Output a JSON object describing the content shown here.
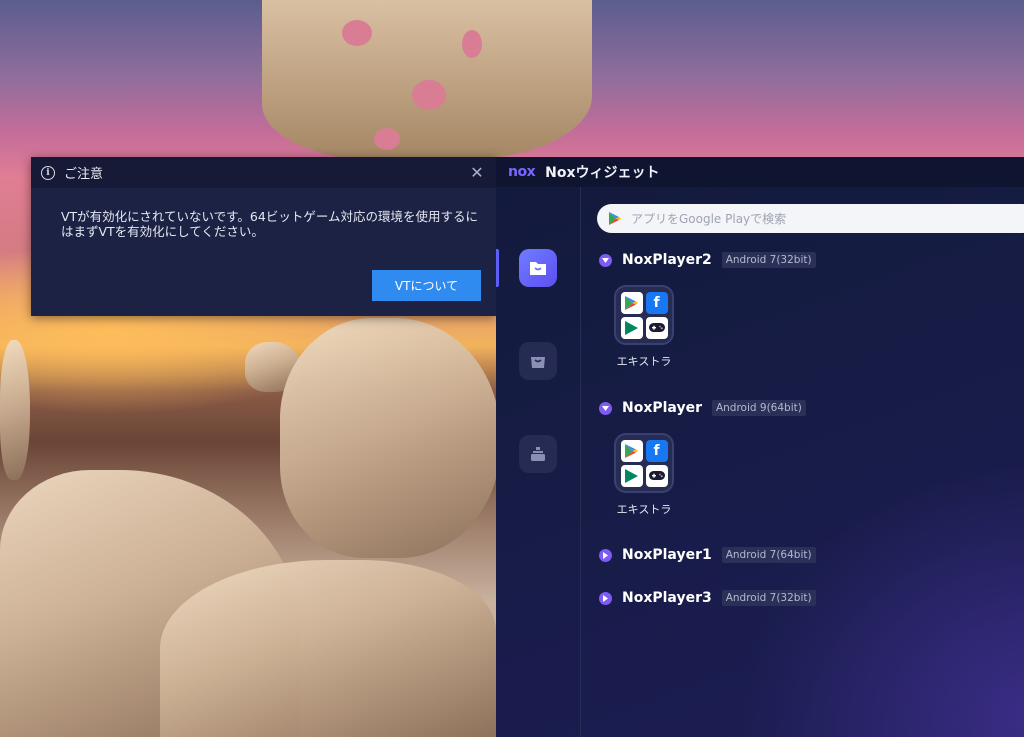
{
  "dialog": {
    "title": "ご注意",
    "message": "VTが有効化にされていないです。64ビットゲーム対応の環境を使用するにはまずVTを有効化にしてください。",
    "button_label": "VTについて"
  },
  "widget": {
    "logo": "nox",
    "title": "Noxウィジェット",
    "search_placeholder": "アプリをGoogle Playで検索",
    "sidebar_items": [
      "home-icon",
      "store-icon",
      "toolbox-icon"
    ],
    "instances": [
      {
        "name": "NoxPlayer2",
        "android": "Android 7(32bit)",
        "expanded": true,
        "apps": [
          {
            "label": "エキストラ"
          }
        ]
      },
      {
        "name": "NoxPlayer",
        "android": "Android 9(64bit)",
        "expanded": true,
        "apps": [
          {
            "label": "エキストラ"
          }
        ]
      },
      {
        "name": "NoxPlayer1",
        "android": "Android 7(64bit)",
        "expanded": false,
        "apps": []
      },
      {
        "name": "NoxPlayer3",
        "android": "Android 7(32bit)",
        "expanded": false,
        "apps": []
      }
    ]
  },
  "colors": {
    "accent": "#7c5cf5",
    "button": "#2f8bf0",
    "widget_bg": "#161c44",
    "dialog_bg": "#1c2244"
  }
}
